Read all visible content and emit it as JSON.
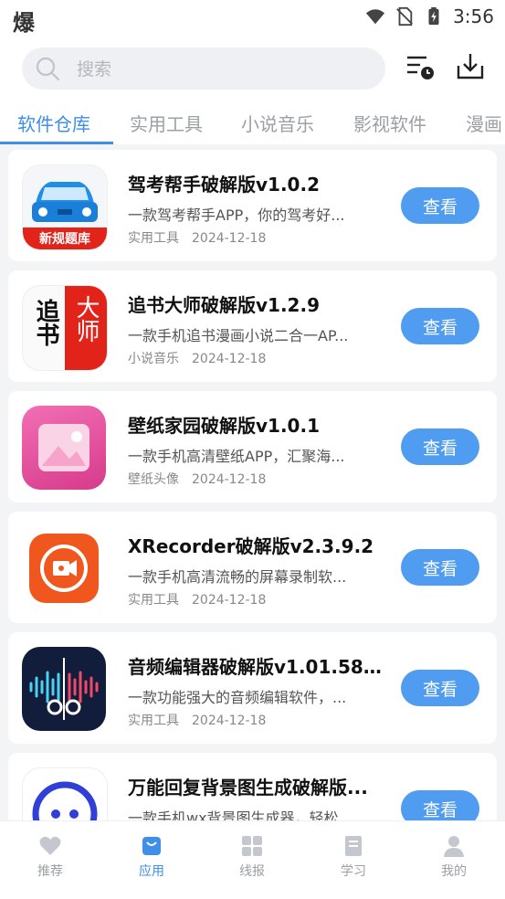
{
  "status": {
    "carrier_glyph": "爆",
    "time": "3:56"
  },
  "search": {
    "placeholder": "搜索",
    "value": ""
  },
  "tabs": [
    "软件仓库",
    "实用工具",
    "小说音乐",
    "影视软件",
    "漫画"
  ],
  "active_tab": 0,
  "apps": [
    {
      "name": "驾考帮手破解版v1.0.2",
      "desc": "一款驾考帮手APP，你的驾考好...",
      "category": "实用工具",
      "date": "2024-12-18",
      "button": "查看",
      "icon": "car-icon",
      "icon_text": "新规题库"
    },
    {
      "name": "追书大师破解版v1.2.9",
      "desc": "一款手机追书漫画小说二合一AP...",
      "category": "小说音乐",
      "date": "2024-12-18",
      "button": "查看",
      "icon": "book-calligraphy-icon",
      "icon_text_left": "追书",
      "icon_text_right": "大师"
    },
    {
      "name": "壁纸家园破解版v1.0.1",
      "desc": "一款手机高清壁纸APP，汇聚海...",
      "category": "壁纸头像",
      "date": "2024-12-18",
      "button": "查看",
      "icon": "wallpaper-image-icon"
    },
    {
      "name": "XRecorder破解版v2.3.9.2",
      "desc": "一款手机高清流畅的屏幕录制软...",
      "category": "实用工具",
      "date": "2024-12-18",
      "button": "查看",
      "icon": "video-recorder-icon"
    },
    {
      "name": "音频编辑器破解版v1.01.58....",
      "desc": "一款功能强大的音频编辑软件，...",
      "category": "实用工具",
      "date": "2024-12-18",
      "button": "查看",
      "icon": "audio-scissors-icon"
    },
    {
      "name": "万能回复背景图生成破解版...",
      "desc": "一款手机wx背景图生成器，轻松...",
      "category": "",
      "date": "",
      "button": "查看",
      "icon": "chat-bubble-icon"
    }
  ],
  "nav": [
    {
      "label": "推荐",
      "icon": "heart-icon"
    },
    {
      "label": "应用",
      "icon": "bag-icon"
    },
    {
      "label": "线报",
      "icon": "grid-icon"
    },
    {
      "label": "学习",
      "icon": "book-icon"
    },
    {
      "label": "我的",
      "icon": "user-icon"
    }
  ],
  "active_nav": 1,
  "colors": {
    "accent": "#3f8ee8",
    "button": "#4f9cf0",
    "background": "#f3f4f6"
  }
}
